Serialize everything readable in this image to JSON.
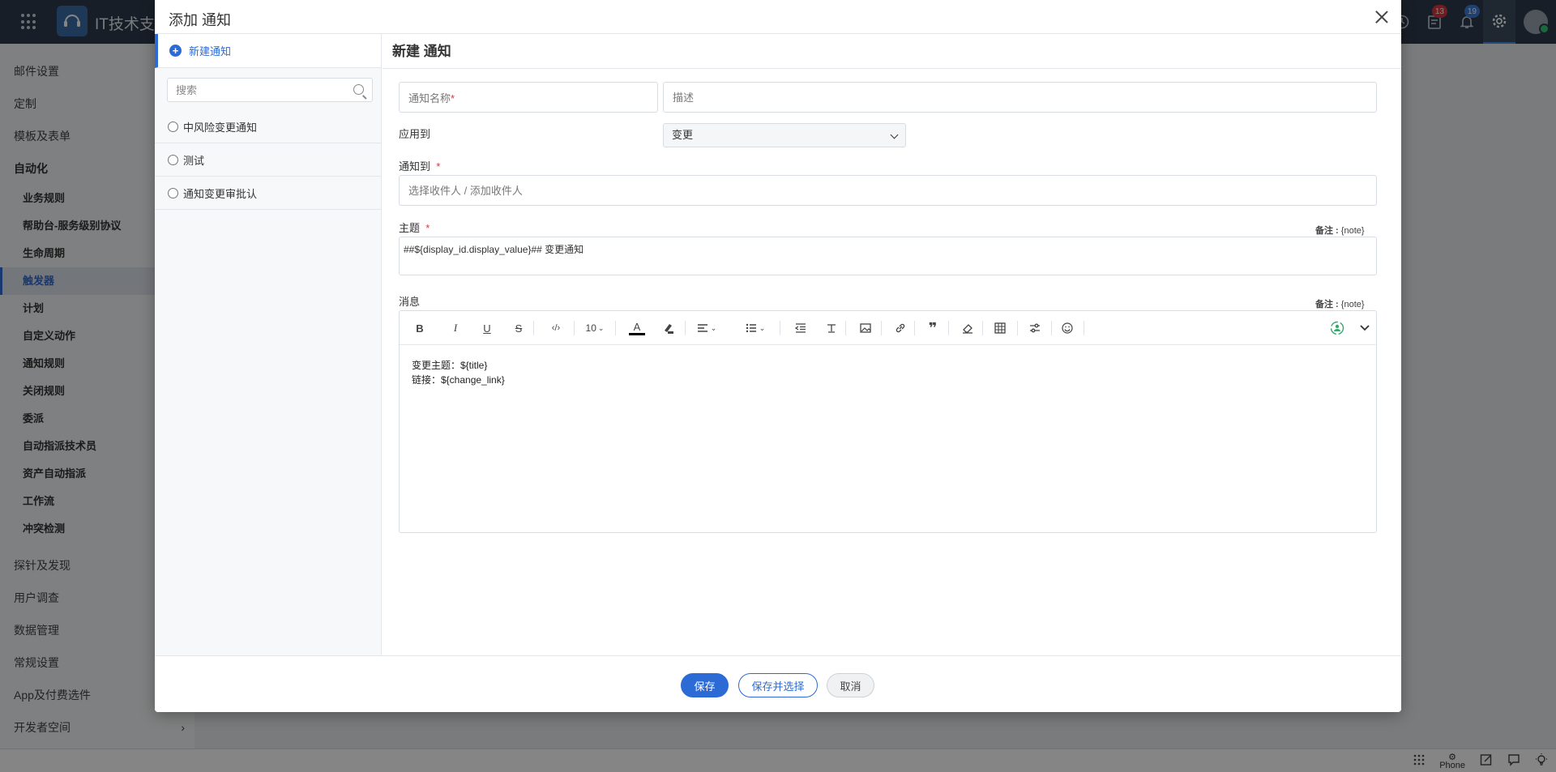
{
  "app": {
    "title": "IT技术支持",
    "badge_tasks": "13",
    "badge_notifications": "19"
  },
  "sidebar": {
    "items_top": [
      "邮件设置",
      "定制",
      "模板及表单"
    ],
    "section": "自动化",
    "sub_items": [
      "业务规则",
      "帮助台-服务级别协议",
      "生命周期",
      "触发器",
      "计划",
      "自定义动作",
      "通知规则",
      "关闭规则",
      "委派",
      "自动指派技术员",
      "资产自动指派",
      "工作流",
      "冲突检测"
    ],
    "active_sub": "触发器",
    "items_bottom": [
      "探针及发现",
      "用户调查",
      "数据管理",
      "常规设置",
      "App及付费选件",
      "开发者空间"
    ]
  },
  "modal": {
    "title": "添加 通知",
    "left": {
      "new_label": "新建通知",
      "search_placeholder": "搜索",
      "items": [
        "中风险变更通知",
        "测试",
        "通知变更审批认"
      ]
    },
    "form": {
      "heading": "新建 通知",
      "name_placeholder": "通知名称",
      "desc_placeholder": "描述",
      "apply_label": "应用到",
      "apply_value": "变更",
      "notify_label": "通知到",
      "notify_placeholder": "选择收件人 / 添加收件人",
      "subject_label": "主题",
      "subject_value": "##${display_id.display_value}## 变更通知",
      "note_label": "备注 :",
      "note_value": "{note}",
      "message_label": "消息",
      "font_size": "10",
      "message_line1": "变更主题：${title}",
      "message_line2": "链接：${change_link}"
    },
    "footer": {
      "save": "保存",
      "save_select": "保存并选择",
      "cancel": "取消"
    }
  },
  "statusbar": {
    "phone": "Phone"
  },
  "colors": {
    "accent": "#2c6bd6",
    "topbar": "#2f3b4b",
    "required": "#d9363e"
  }
}
